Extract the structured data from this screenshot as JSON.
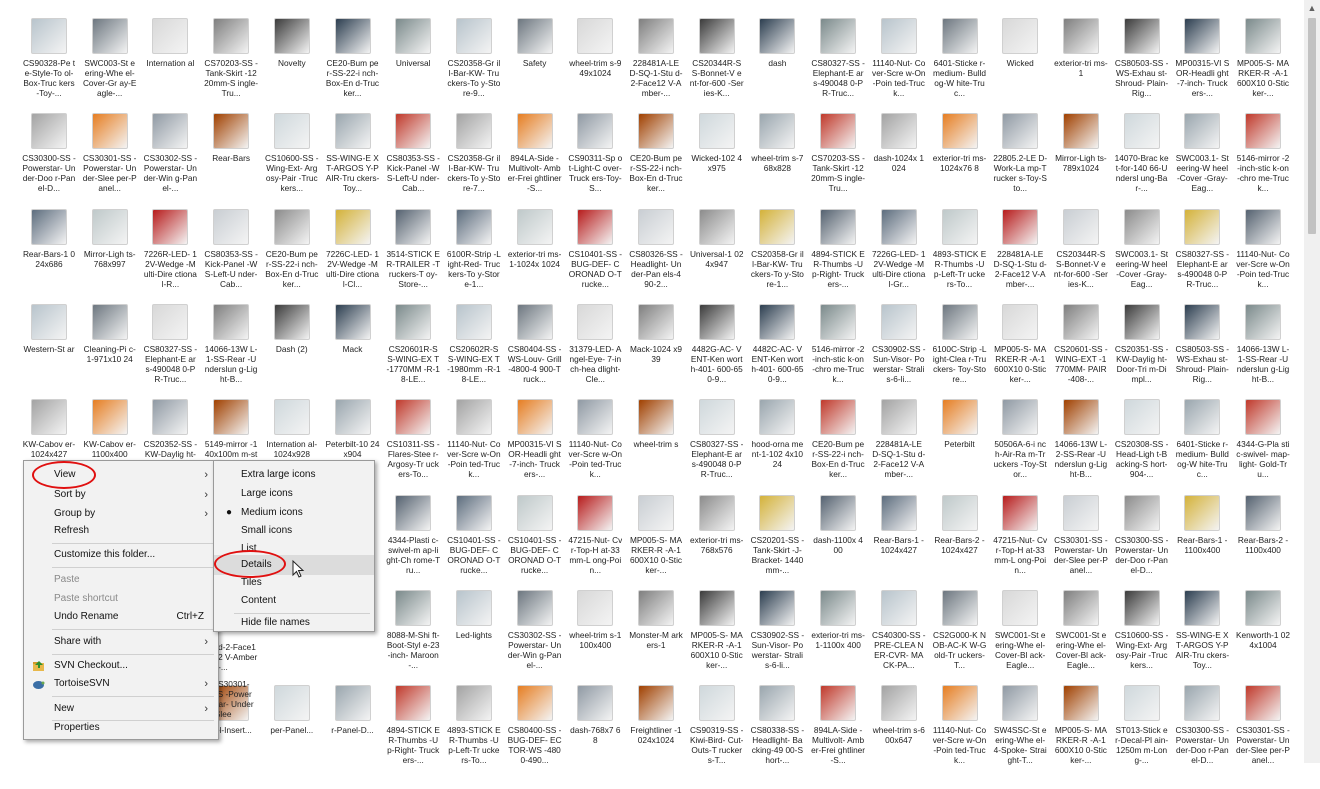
{
  "rows": [
    [
      "CS90328-Pe te-Style-To ol-Box-Truc kers-Toy-...",
      "SWC003-St eering-Whe el-Cover-Gr ay-Eagle-...",
      "Internation al",
      "CS70203-SS -Tank-Skirt -1220mm-S ingle-Tru...",
      "Novelty",
      "CE20-Bum per-SS-22-i nch-Box-En d-Trucker...",
      "Universal",
      "CS20358-Gr ill-Bar-KW- Truckers-To y-Store-9...",
      "Safety",
      "wheel-trim s-949x1024",
      "228481A-LE D-SQ-1-Stu d-2-Face12 V-Amber-...",
      "CS20344R-S S-Bonnet-V ent-for-600 -Series-K...",
      "dash",
      "CS80327-SS -Elephant-E ars-490048 0-PR-Truc...",
      "11140-Nut- Cover-Scre w-On-Poin ted-Truck...",
      "6401-Sticke r-medium- Bulldog-W hite-Truc...",
      "Wicked",
      "exterior-tri ms-1",
      "CS80503-SS -WS-Exhau st-Shroud- Plain-Rig...",
      "MP00315-VI SOR-Headli ght-7-inch- Truckers-...",
      "MP005-S- MARKER-R -A-1600X10 0-Sticker-..."
    ],
    [
      "CS30300-SS -Powerstar- Under-Doo r-Panel-D...",
      "CS30301-SS -Powerstar- Under-Slee per-Panel...",
      "CS30302-SS -Powerstar- Under-Win g-Panel-...",
      "Rear-Bars",
      "CS10600-SS -Wing-Ext- Argosy-Pair -Truckers...",
      "SS-WING-E XT-ARGOS Y-PAIR-Tru ckers-Toy...",
      "CS80353-SS -Kick-Panel -WS-Left-U nder-Cab...",
      "CS20358-Gr ill-Bar-KW- Truckers-To y-Store-7...",
      "894LA-Side -Multivolt- Amber-Frei ghtliner-S...",
      "CS90311-Sp ot-Light-C over-Truck ers-Toy-S...",
      "CE20-Bum per-SS-22-i nch-Box-En d-Trucker...",
      "Wicked-102 4x975",
      "wheel-trim s-768x828",
      "CS70203-SS -Tank-Skirt -1220mm-S ingle-Tru...",
      "dash-1024x 1024",
      "exterior-tri ms-1024x76 8",
      "22805.2-LE D-Work-La mp-Trucker s-Toy-Sto...",
      "Mirror-Ligh ts-789x1024",
      "14070-Brac ket-for-140 66-Undersl ung-Bar-...",
      "SWC003.1- Steering-W heel-Cover -Gray-Eag...",
      "5146-mirror -2-inch-stic k-on-chro me-Truck..."
    ],
    [
      "Rear-Bars-1 024x686",
      "Mirror-Ligh ts-768x997",
      "7226R-LED- 12V-Wedge -Multi-Dire ctional-R...",
      "CS80353-SS -Kick-Panel -WS-Left-U nder-Cab...",
      "CE20-Bum per-SS-22-i nch-Box-En d-Trucker...",
      "7226C-LED- 12V-Wedge -Multi-Dire ctional-Cl...",
      "3514-STICK ER-TRAILER -Truckers-T oy-Store-...",
      "6100R-Strip -Light-Red- Truckers-To y-Store-1...",
      "exterior-tri ms-1-1024x 1024",
      "CS10401-SS -BUG-DEF- CORONAD O-Trucke...",
      "CS80326-SS -Headlight- Under-Pan els-490-2...",
      "Universal-1 024x947",
      "CS20358-Gr ill-Bar-KW- Truckers-To y-Store-1...",
      "4894-STICK ER-Thumbs -Up-Right- Truckers-...",
      "7226G-LED- 12V-Wedge -Multi-Dire ctional-Gr...",
      "4893-STICK ER-Thumbs -Up-Left-Tr uckers-To...",
      "228481A-LE D-SQ-1-Stu d-2-Face12 V-Amber-...",
      "CS20344R-S S-Bonnet-V ent-for-600 -Series-K...",
      "SWC003.1- Steering-W heel-Cover -Gray-Eag...",
      "CS80327-SS -Elephant-E ars-490048 0-PR-Truc...",
      "11140-Nut- Cover-Scre w-On-Poin ted-Truck..."
    ],
    [
      "Western-St ar",
      "Cleaning-Pi c-1-971x10 24",
      "CS80327-SS -Elephant-E ars-490048 0-PR-Truc...",
      "14066-13W L-1-SS-Rear -Underslun g-Light-B...",
      "Dash (2)",
      "Mack",
      "CS20601R-S S-WING-EX T-1770MM -R-18-LE...",
      "CS20602R-S S-WING-EX T-1980mm -R-18-LE...",
      "CS80404-SS -WS-Louv- Grill-4800-4 900-Truck...",
      "31379-LED- Angel-Eye- 7-inch-hea dlight-Cle...",
      "Mack-1024 x939",
      "4482G-AC- VENT-Ken worth-401- 600-650-9...",
      "4482C-AC- VENT-Ken worth-401- 600-650-9...",
      "5146-mirror -2-inch-stic k-on-chro me-Truck...",
      "CS30902-SS -Sun-Visor- Powerstar- Stralis-6-li...",
      "6100C-Strip -Light-Clea r-Truckers- Toy-Store...",
      "MP005-S- MARKER-R -A-1600X10 0-Sticker-...",
      "CS20601-SS -WING-EXT -1770MM- PAIR-408-...",
      "CS20351-SS -KW-Daylig ht-Door-Tri m-Dimpl...",
      "CS80503-SS -WS-Exhau st-Shroud- Plain-Rig...",
      "14066-13W L-1-SS-Rear -Underslun g-Light-B..."
    ],
    [
      "KW-Cabov er-1024x427",
      "KW-Cabov er-1100x400",
      "CS20352-SS -KW-Daylig ht-Door-Tri",
      "5149-mirror -140x100m m-stickon-",
      "Internation al-1024x928",
      "Peterbilt-10 24x904",
      "CS10311-SS -Flares-Stee r-Argosy-Tr uckers-To...",
      "11140-Nut- Cover-Scre w-On-Poin ted-Truck...",
      "MP00315-VI SOR-Headli ght-7-inch- Truckers-...",
      "11140-Nut- Cover-Scre w-On-Poin ted-Truck...",
      "wheel-trim s",
      "CS80327-SS -Elephant-E ars-490048 0-PR-Truc...",
      "hood-orna ment-1-102 4x1024",
      "CE20-Bum per-SS-22-i nch-Box-En d-Trucker...",
      "228481A-LE D-SQ-1-Stu d-2-Face12 V-Amber-...",
      "Peterbilt",
      "50506A-6-i nch-Air-Ra m-Truckers -Toy-Stor...",
      "14066-13W L-2-SS-Rear -Underslun g-Light-B...",
      "CS20308-SS -Head-Ligh t-Backing-S hort-904-...",
      "6401-Sticke r-medium- Bulldog-W hite-Truc...",
      "4344-G-Pla stic-swivel- map-light- Gold-Tru..."
    ],
    [
      "",
      "",
      "",
      "",
      "",
      "",
      "4344-Plasti c-swivel-m ap-light-Ch rome-Tru...",
      "CS10401-SS -BUG-DEF- CORONAD O-Trucke...",
      "CS10401-SS -BUG-DEF- CORONAD O-Trucke...",
      "47215-Nut- Cvr-Top-H at-33mm-L ong-Poin...",
      "MP005-S- MARKER-R -A-1600X10 0-Sticker-...",
      "exterior-tri ms-768x576",
      "CS20201-SS -Tank-Skirt -J-Bracket- 1440mm-...",
      "dash-1100x 400",
      "Rear-Bars-1 -1024x427",
      "Rear-Bars-2 -1024x427",
      "47215-Nut- Cvr-Top-H at-33mm-L ong-Poin...",
      "CS30301-SS -Powerstar- Under-Slee per-Panel...",
      "CS30300-SS -Powerstar- Under-Doo r-Panel-D...",
      "Rear-Bars-1 -1100x400",
      "Rear-Bars-2 -1100x400"
    ],
    [
      "",
      "",
      "",
      "",
      "",
      "",
      "8088-M-Shi ft-Boot-Styl e-23-inch- Maroon-...",
      "Led-lights",
      "CS30302-SS -Powerstar- Under-Win g-Panel-...",
      "wheel-trim s-1100x400",
      "Monster-M arkers-1",
      "MP005-S- MARKER-R -A-1600X10 0-Sticker-...",
      "CS30902-SS -Sun-Visor- Powerstar- Stralis-6-li...",
      "exterior-tri ms-1-1100x 400",
      "CS40300-SS -PRE-CLEA NER-CVR- MACK-PA...",
      "CS2G000-K NOB-AC-K W-Gold-Tr uckers-T...",
      "SWC001-St eering-Whe el-Cover-Bl ack-Eagle...",
      "SWC001-St eering-Whe el-Cover-Bl ack-Eagle...",
      "CS10600-SS -Wing-Ext- Argosy-Pair -Truckers...",
      "SS-WING-E XT-ARGOS Y-PAIR-Tru ckers-Toy...",
      "Kenworth-1 024x1004"
    ],
    [
      "ers-Toy-S...",
      "ingle-Tru...",
      "-4800-490...",
      "del-Insert...",
      "per-Panel...",
      "r-Panel-D...",
      "4894-STICK ER-Thumbs -Up-Right- Truckers-...",
      "4893-STICK ER-Thumbs -Up-Left-Tr uckers-To...",
      "CS80400-SS -BUG-DEF- ECTOR-WS -4800-490...",
      "dash-768x7 68",
      "Freightliner -1024x1024",
      "CS90319-SS -Kiwi-Bird- Cut-Outs-T ruckers-T...",
      "CS80338-SS -Headlight- Backing-49 00-Short-...",
      "894LA-Side -Multivolt- Amber-Frei ghtliner-S...",
      "wheel-trim s-600x647",
      "11140-Nut- Cover-Scre w-On-Poin ted-Truck...",
      "SW4SSC-St eering-Whe el-4-Spoke- Straight-T...",
      "MP005-S- MARKER-R -A-1600X10 0-Sticker-...",
      "ST013-Stick er-Decal-Pl ain-1250m m-Long-...",
      "CS30300-SS -Powerstar- Under-Doo r-Panel-D...",
      "CS30301-SS -Powerstar- Under-Slee per-Panel..."
    ]
  ],
  "partial_captions": {
    "row6_col2": "r-W-Mo 0-904-9 -909-pa...",
    "row6_col3": "d-2-Face12 V-Amber-...",
    "row7_col2": "20402-SS g-Defle",
    "row7_col3": "CS30301-SS -Powerstar- Under-Slee"
  },
  "thumb_colors": [
    "#b8c4cc",
    "#9aa6ae",
    "#c9ced3",
    "#6d7780",
    "#c0392b",
    "#8c8c8c",
    "#d8d8d8",
    "#a3a3a3",
    "#d4b23a",
    "#7f7f7f",
    "#e67e22",
    "#556270",
    "#3b3b3b",
    "#909aa4",
    "#5d6d7e",
    "#2c3e50",
    "#a04000",
    "#bfc9ca",
    "#7b8a8b",
    "#cfd8dc",
    "#b71c1c"
  ],
  "context_menu": {
    "items": [
      {
        "label": "View",
        "submenu": true
      },
      {
        "label": "Sort by",
        "submenu": true
      },
      {
        "label": "Group by",
        "submenu": true
      },
      {
        "label": "Refresh"
      },
      {
        "label": "Customize this folder..."
      },
      {
        "label": "Paste",
        "disabled": true
      },
      {
        "label": "Paste shortcut",
        "disabled": true
      },
      {
        "label": "Undo Rename",
        "shortcut": "Ctrl+Z"
      },
      {
        "label": "Share with",
        "submenu": true
      },
      {
        "label": "SVN Checkout..."
      },
      {
        "label": "TortoiseSVN",
        "submenu": true
      },
      {
        "label": "New",
        "submenu": true
      },
      {
        "label": "Properties"
      }
    ]
  },
  "view_submenu": {
    "items": [
      {
        "label": "Extra large icons"
      },
      {
        "label": "Large icons"
      },
      {
        "label": "Medium icons",
        "selected": true
      },
      {
        "label": "Small icons"
      },
      {
        "label": "List"
      },
      {
        "label": "Details",
        "highlighted": true
      },
      {
        "label": "Tiles"
      },
      {
        "label": "Content"
      },
      {
        "label": "Hide file names"
      }
    ]
  },
  "icons": {
    "submenu_arrow": "chevron-right-icon",
    "radio_dot": "bullet-icon",
    "scroll_up": "scroll-up-arrow-icon"
  }
}
